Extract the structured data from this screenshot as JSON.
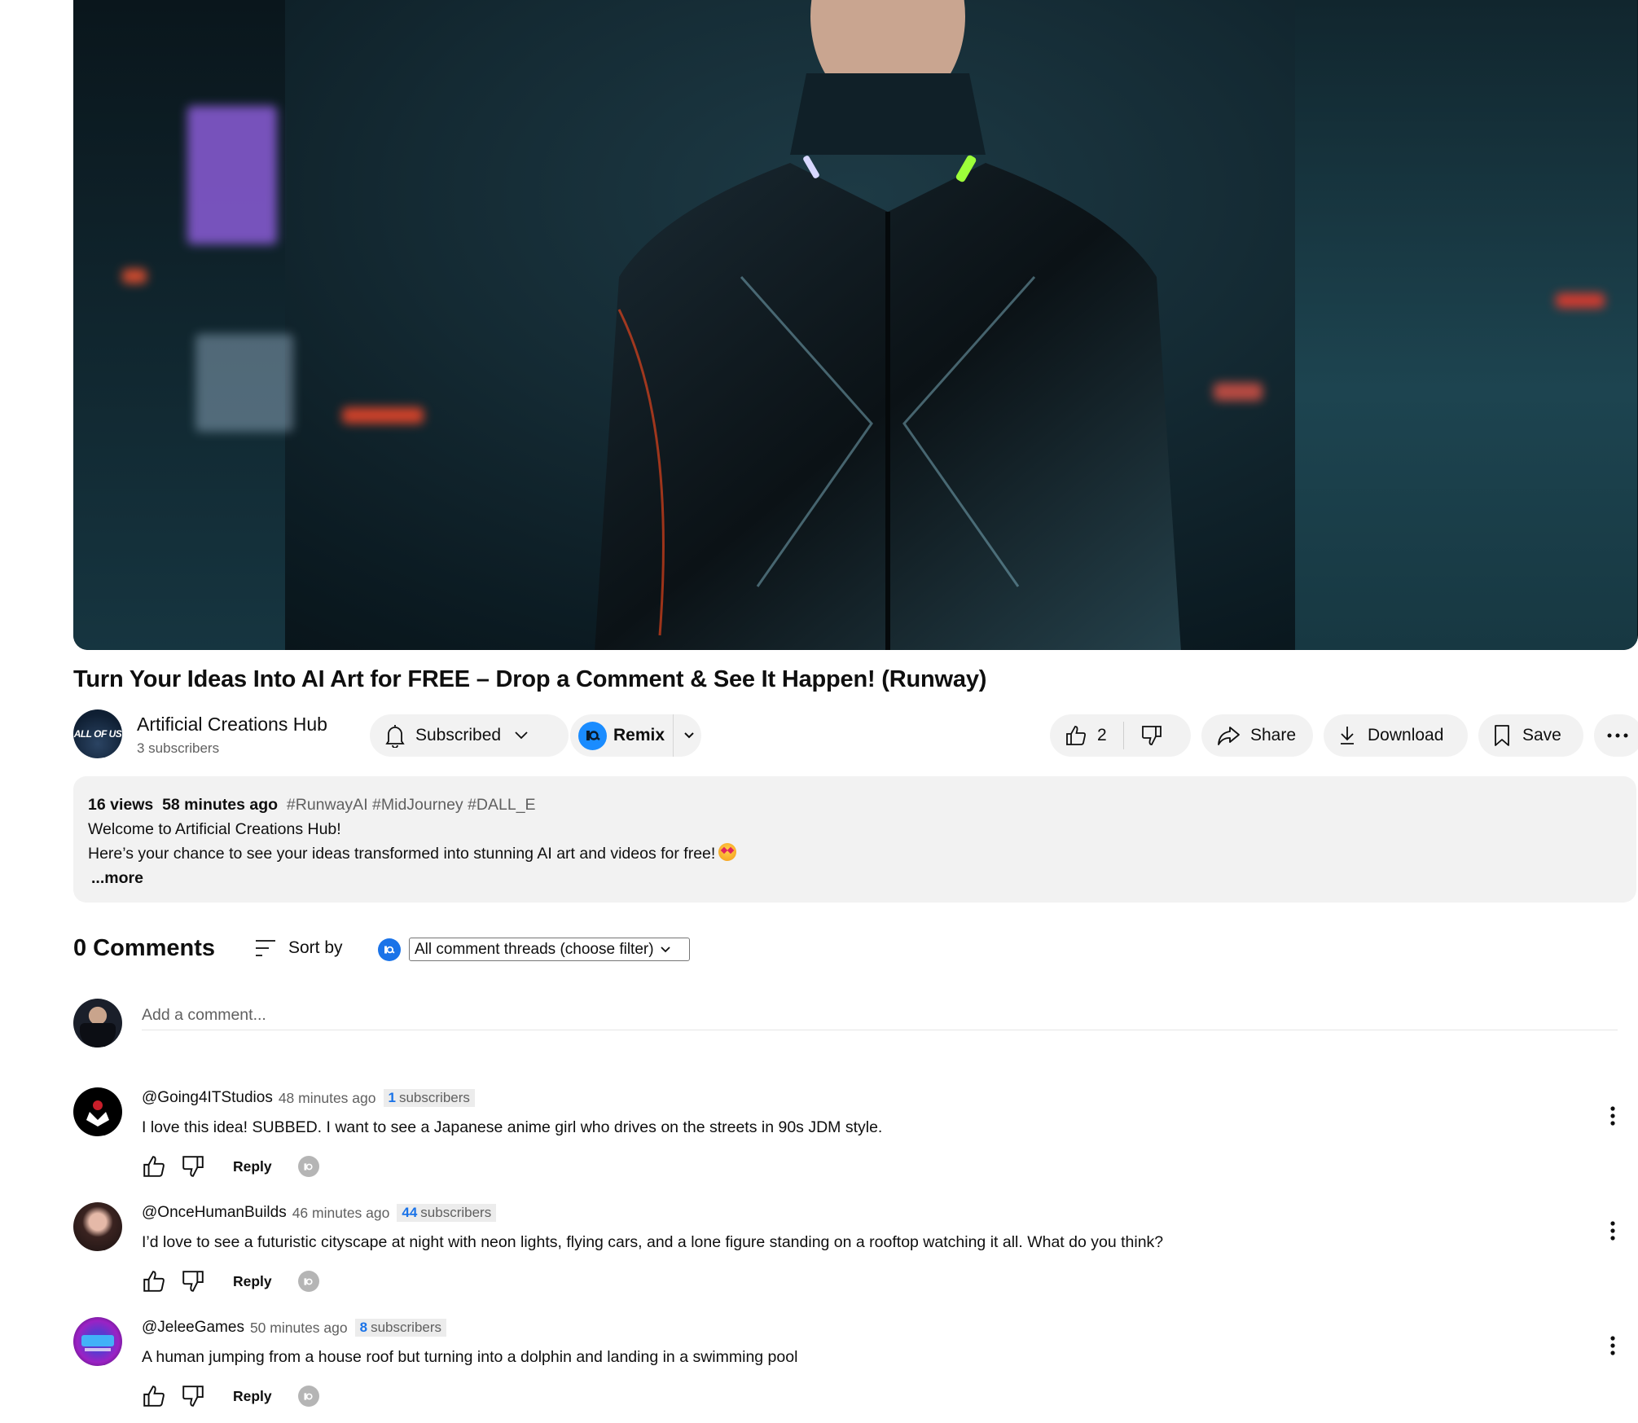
{
  "video": {
    "title": "Turn Your Ideas Into AI Art for FREE – Drop a Comment & See It Happen! (Runway)"
  },
  "channel": {
    "avatar_text": "ALL OF US",
    "name": "Artificial Creations Hub",
    "subscribers": "3 subscribers",
    "subscribe_label": "Subscribed",
    "remix_label": "Remix"
  },
  "actions": {
    "like_count": "2",
    "share_label": "Share",
    "download_label": "Download",
    "save_label": "Save"
  },
  "description": {
    "views": "16 views",
    "age": "58 minutes ago",
    "tags": "#RunwayAI #MidJourney #DALL_E",
    "line1": "Welcome to Artificial Creations Hub!",
    "line2": "Here’s your chance to see your ideas transformed into stunning AI art and videos for free!",
    "more_label": "...more"
  },
  "comments_header": {
    "count_label": "0 Comments",
    "sort_label": "Sort by",
    "filter_selected": "All comment threads (choose filter)"
  },
  "add_comment": {
    "placeholder": "Add a comment..."
  },
  "comments": [
    {
      "author": "@Going4ITStudios",
      "time": "48 minutes ago",
      "sub_count": "1",
      "sub_label": "subscribers",
      "text": "I love this idea! SUBBED. I want to see a Japanese anime girl who drives on the streets in 90s JDM style.",
      "reply_label": "Reply"
    },
    {
      "author": "@OnceHumanBuilds",
      "time": "46 minutes ago",
      "sub_count": "44",
      "sub_label": "subscribers",
      "text": "I’d love to see a futuristic cityscape at night with neon lights, flying cars, and a lone figure standing on a rooftop watching it all. What do you think?",
      "reply_label": "Reply"
    },
    {
      "author": "@JeleeGames",
      "time": "50 minutes ago",
      "sub_count": "8",
      "sub_label": "subscribers",
      "text": "A human jumping from a house roof but turning into a dolphin and landing in a swimming pool",
      "reply_label": "Reply"
    }
  ],
  "colors": {
    "accent_blue": "#1a73e8",
    "remix_blue": "#1a8cff",
    "pill_bg": "#f2f2f2",
    "secondary_text": "#606060"
  }
}
